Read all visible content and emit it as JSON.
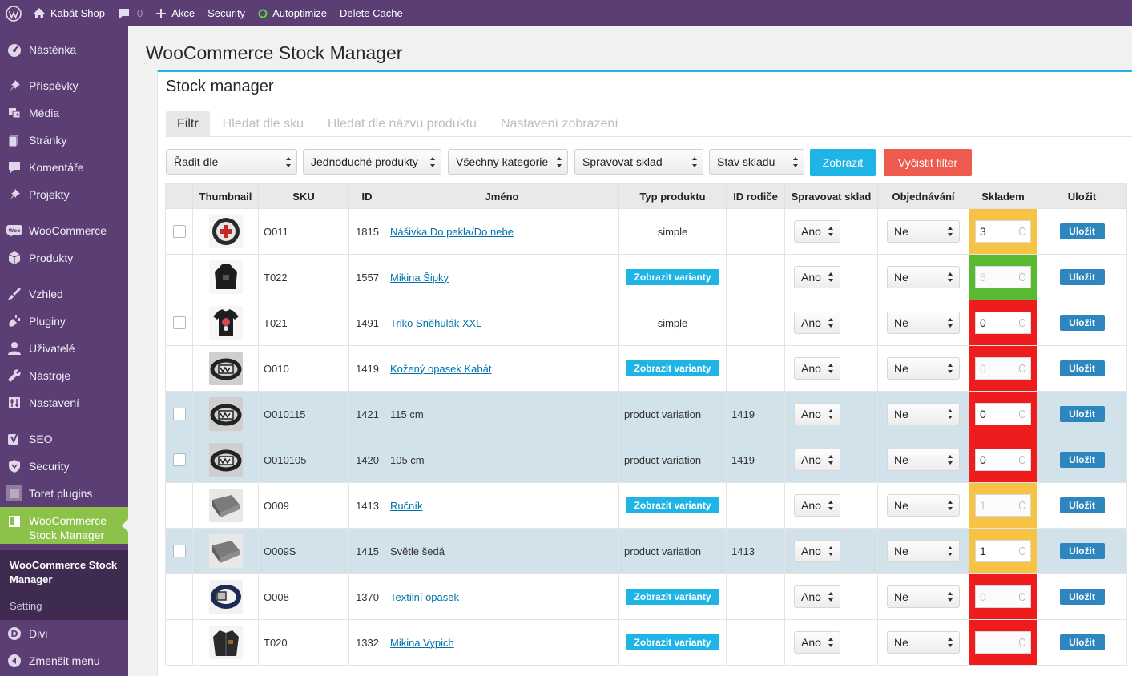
{
  "adminbar": {
    "site_name": "Kabát Shop",
    "comments_count": "0",
    "new_label": "Akce",
    "security_label": "Security",
    "autoptimize_label": "Autoptimize",
    "delete_cache_label": "Delete Cache"
  },
  "sidebar": {
    "items": [
      {
        "label": "Nástěnka",
        "icon": "dashboard-icon"
      },
      {
        "label": "Příspěvky",
        "icon": "pin-icon"
      },
      {
        "label": "Média",
        "icon": "media-icon"
      },
      {
        "label": "Stránky",
        "icon": "pages-icon"
      },
      {
        "label": "Komentáře",
        "icon": "comments-icon"
      },
      {
        "label": "Projekty",
        "icon": "pin-icon"
      },
      {
        "label": "WooCommerce",
        "icon": "woo-icon"
      },
      {
        "label": "Produkty",
        "icon": "box-icon"
      },
      {
        "label": "Vzhled",
        "icon": "brush-icon"
      },
      {
        "label": "Pluginy",
        "icon": "plugin-icon"
      },
      {
        "label": "Uživatelé",
        "icon": "user-icon"
      },
      {
        "label": "Nástroje",
        "icon": "wrench-icon"
      },
      {
        "label": "Nastavení",
        "icon": "settings-icon"
      },
      {
        "label": "SEO",
        "icon": "seo-icon"
      },
      {
        "label": "Security",
        "icon": "shield-icon"
      },
      {
        "label": "Toret plugins",
        "icon": "toret-icon"
      }
    ],
    "current": {
      "label_line1": "WooCommerce",
      "label_line2": "Stock Manager"
    },
    "submenu": {
      "title": "WooCommerce Stock Manager",
      "setting": "Setting"
    },
    "after": [
      {
        "label": "Divi",
        "icon": "divi-icon"
      },
      {
        "label": "Zmenšit menu",
        "icon": "collapse-icon"
      }
    ]
  },
  "page": {
    "title": "WooCommerce Stock Manager",
    "panel_title": "Stock manager"
  },
  "tabs": [
    {
      "label": "Filtr",
      "active": true
    },
    {
      "label": "Hledat dle sku",
      "active": false
    },
    {
      "label": "Hledat dle názvu produktu",
      "active": false
    },
    {
      "label": "Nastavení zobrazení",
      "active": false
    }
  ],
  "filters": {
    "sort": "Řadit dle",
    "product_type": "Jednoduché produkty",
    "category": "Všechny kategorie",
    "manage_stock": "Spravovat sklad",
    "stock_status": "Stav skladu",
    "show_button": "Zobrazit",
    "clear_button": "Vyčistit filter"
  },
  "table": {
    "headers": [
      "",
      "Thumbnail",
      "SKU",
      "ID",
      "Jméno",
      "Typ produktu",
      "ID rodiče",
      "Spravovat sklad",
      "Objednávání",
      "Skladem",
      "Uložit"
    ],
    "variants_button": "Zobrazit varianty",
    "save_label": "Uložit",
    "rows": [
      {
        "sku": "O011",
        "id": "1815",
        "name": "Nášivka Do pekla/Do nebe",
        "type": "simple",
        "parent": "",
        "manage": "Ano",
        "backorders": "Ne",
        "stock": "3",
        "status": "orange",
        "checkbox": true,
        "variable": false,
        "link": true,
        "variation": false,
        "stock_disabled": false,
        "thumb": "patch"
      },
      {
        "sku": "T022",
        "id": "1557",
        "name": "Mikina Šipky",
        "type": "",
        "parent": "",
        "manage": "Ano",
        "backorders": "Ne",
        "stock": "5",
        "status": "green",
        "checkbox": false,
        "variable": true,
        "link": true,
        "variation": false,
        "stock_disabled": true,
        "thumb": "hoodie"
      },
      {
        "sku": "T021",
        "id": "1491",
        "name": "Triko Sněhulák XXL",
        "type": "simple",
        "parent": "",
        "manage": "Ano",
        "backorders": "Ne",
        "stock": "0",
        "status": "red",
        "checkbox": true,
        "variable": false,
        "link": true,
        "variation": false,
        "stock_disabled": false,
        "thumb": "tshirt"
      },
      {
        "sku": "O010",
        "id": "1419",
        "name": "Kožený opasek Kabát",
        "type": "",
        "parent": "",
        "manage": "Ano",
        "backorders": "Ne",
        "stock": "0",
        "status": "red",
        "checkbox": false,
        "variable": true,
        "link": true,
        "variation": false,
        "stock_disabled": true,
        "thumb": "belt"
      },
      {
        "sku": "O010115",
        "id": "1421",
        "name": "115 cm",
        "type": "product variation",
        "parent": "1419",
        "manage": "Ano",
        "backorders": "Ne",
        "stock": "0",
        "status": "red",
        "checkbox": true,
        "variable": false,
        "link": false,
        "variation": true,
        "stock_disabled": false,
        "thumb": "belt"
      },
      {
        "sku": "O010105",
        "id": "1420",
        "name": "105 cm",
        "type": "product variation",
        "parent": "1419",
        "manage": "Ano",
        "backorders": "Ne",
        "stock": "0",
        "status": "red",
        "checkbox": true,
        "variable": false,
        "link": false,
        "variation": true,
        "stock_disabled": false,
        "thumb": "belt"
      },
      {
        "sku": "O009",
        "id": "1413",
        "name": "Ručník",
        "type": "",
        "parent": "",
        "manage": "Ano",
        "backorders": "Ne",
        "stock": "1",
        "status": "orange",
        "checkbox": false,
        "variable": true,
        "link": true,
        "variation": false,
        "stock_disabled": true,
        "thumb": "towel"
      },
      {
        "sku": "O009S",
        "id": "1415",
        "name": "Světle šedá",
        "type": "product variation",
        "parent": "1413",
        "manage": "Ano",
        "backorders": "Ne",
        "stock": "1",
        "status": "orange",
        "checkbox": true,
        "variable": false,
        "link": false,
        "variation": true,
        "stock_disabled": false,
        "thumb": "towel"
      },
      {
        "sku": "O008",
        "id": "1370",
        "name": "Textilní opasek",
        "type": "",
        "parent": "",
        "manage": "Ano",
        "backorders": "Ne",
        "stock": "0",
        "status": "red",
        "checkbox": false,
        "variable": true,
        "link": true,
        "variation": false,
        "stock_disabled": true,
        "thumb": "textile-belt"
      },
      {
        "sku": "T020",
        "id": "1332",
        "name": "Mikina Vypich",
        "type": "",
        "parent": "",
        "manage": "Ano",
        "backorders": "Ne",
        "stock": "",
        "status": "red",
        "checkbox": false,
        "variable": true,
        "link": true,
        "variation": false,
        "stock_disabled": true,
        "thumb": "jacket"
      }
    ]
  },
  "colors": {
    "admin_purple": "#5b3f74",
    "submenu_dark": "#3f2b50",
    "current_green": "#8cc24a",
    "accent_blue": "#1fb4e6",
    "save_blue": "#2e86bf",
    "clear_red": "#ef5a4f",
    "stock_orange": "#f6c344",
    "stock_green": "#59b931",
    "stock_red": "#ee1c1c",
    "variation_row": "#d2e2ea"
  }
}
